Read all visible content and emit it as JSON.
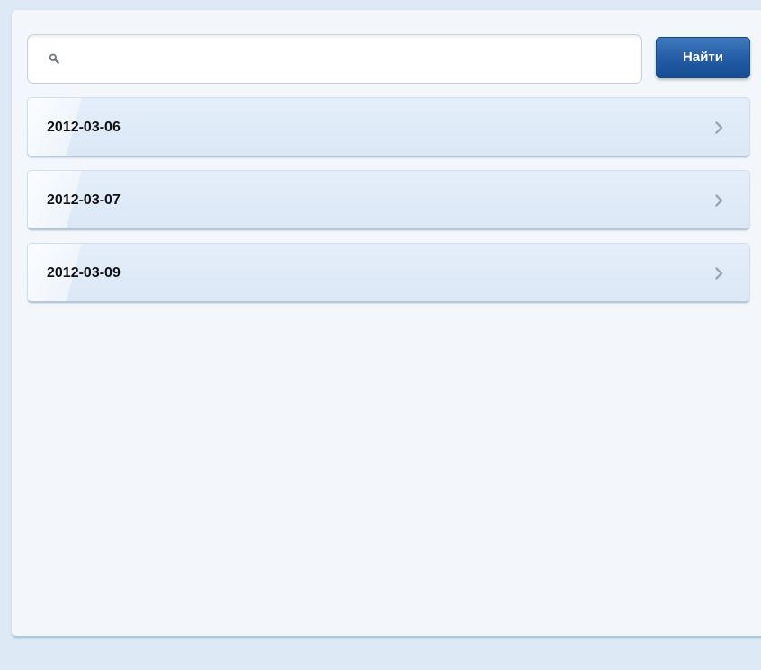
{
  "search": {
    "value": "",
    "placeholder": "",
    "button_label": "Найти",
    "icon": "search-icon"
  },
  "list": {
    "items": [
      {
        "label": "2012-03-06",
        "icon": "chevron-right-icon"
      },
      {
        "label": "2012-03-07",
        "icon": "chevron-right-icon"
      },
      {
        "label": "2012-03-09",
        "icon": "chevron-right-icon"
      }
    ]
  },
  "colors": {
    "background": "#dde9f5",
    "panel": "#f3f7fc",
    "button": "#255ea7",
    "list_item": "#e0ebf8",
    "chevron": "#9aa6b2"
  }
}
